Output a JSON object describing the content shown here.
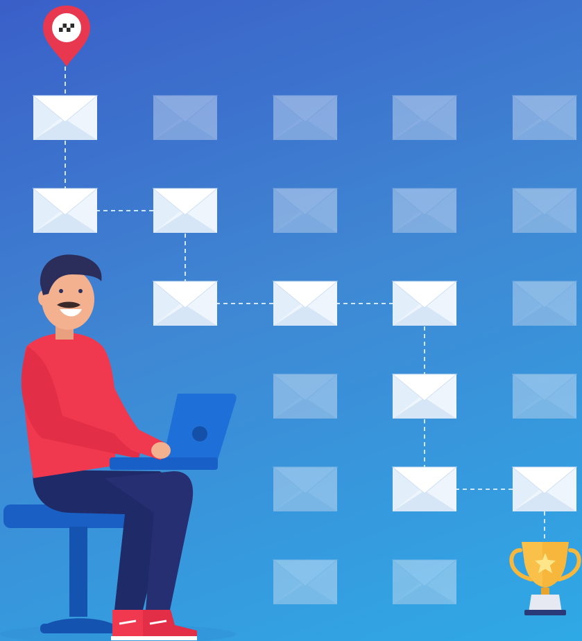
{
  "colors": {
    "background_top": "#3a5fc8",
    "background_bottom": "#2fa9e6",
    "envelope_active": "#eef5fc",
    "envelope_inactive": "#9fc3ea",
    "path_line": "#cfe6fb",
    "pin": "#e8384f",
    "trophy": "#f6b73c",
    "shirt": "#f0394e",
    "pants": "#1f2a68",
    "laptop": "#1f6fd8",
    "chair": "#1a5fc4",
    "shoes": "#f0394e"
  },
  "grid": {
    "columns": 5,
    "rows": 6,
    "envelopes": [
      {
        "row": 0,
        "col": 0,
        "active": true
      },
      {
        "row": 0,
        "col": 1,
        "active": false
      },
      {
        "row": 0,
        "col": 2,
        "active": false
      },
      {
        "row": 0,
        "col": 3,
        "active": false
      },
      {
        "row": 0,
        "col": 4,
        "active": false
      },
      {
        "row": 1,
        "col": 0,
        "active": true
      },
      {
        "row": 1,
        "col": 1,
        "active": true
      },
      {
        "row": 1,
        "col": 2,
        "active": false
      },
      {
        "row": 1,
        "col": 3,
        "active": false
      },
      {
        "row": 1,
        "col": 4,
        "active": false
      },
      {
        "row": 2,
        "col": 1,
        "active": true
      },
      {
        "row": 2,
        "col": 2,
        "active": true
      },
      {
        "row": 2,
        "col": 3,
        "active": true
      },
      {
        "row": 2,
        "col": 4,
        "active": false
      },
      {
        "row": 3,
        "col": 2,
        "active": false
      },
      {
        "row": 3,
        "col": 3,
        "active": true
      },
      {
        "row": 3,
        "col": 4,
        "active": false
      },
      {
        "row": 4,
        "col": 2,
        "active": false
      },
      {
        "row": 4,
        "col": 3,
        "active": true
      },
      {
        "row": 4,
        "col": 4,
        "active": true
      },
      {
        "row": 5,
        "col": 2,
        "active": false
      },
      {
        "row": 5,
        "col": 3,
        "active": false
      }
    ],
    "path": [
      {
        "row": 0,
        "col": 0
      },
      {
        "row": 1,
        "col": 0
      },
      {
        "row": 1,
        "col": 1
      },
      {
        "row": 2,
        "col": 1
      },
      {
        "row": 2,
        "col": 2
      },
      {
        "row": 2,
        "col": 3
      },
      {
        "row": 3,
        "col": 3
      },
      {
        "row": 4,
        "col": 3
      },
      {
        "row": 4,
        "col": 4
      }
    ]
  },
  "icons": {
    "start": "map-pin-icon",
    "finish": "trophy-icon",
    "envelope": "envelope-icon"
  },
  "illustration": {
    "character": "man-with-laptop"
  }
}
